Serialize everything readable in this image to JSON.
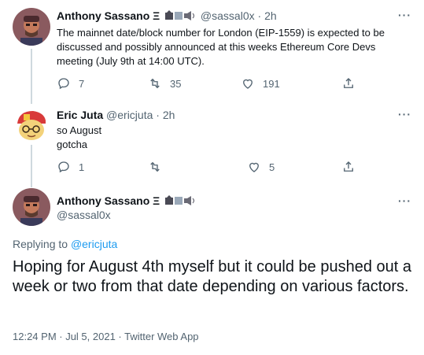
{
  "tweets": [
    {
      "name": "Anthony Sassano Ξ",
      "handle": "@sassal0x",
      "sep": "·",
      "time": "2h",
      "text": "The mainnet date/block number for London (EIP-1559) is expected to be discussed and possibly announced at this weeks Ethereum Core Devs meeting (July 9th at 14:00 UTC).",
      "replies": "7",
      "retweets": "35",
      "likes": "191"
    },
    {
      "name": "Eric Juta",
      "handle": "@ericjuta",
      "sep": "·",
      "time": "2h",
      "text_lines": [
        "so August",
        "gotcha"
      ],
      "replies": "1",
      "retweets": "",
      "likes": "5"
    }
  ],
  "main_tweet": {
    "name": "Anthony Sassano Ξ",
    "handle": "@sassal0x",
    "replying_prefix": "Replying to",
    "replying_to": "@ericjuta",
    "text": "Hoping for August 4th myself but it could be pushed out a week or two from that date depending on various factors.",
    "meta": "12:24 PM · Jul 5, 2021 · Twitter Web App"
  },
  "icons": {
    "reply": "reply-icon",
    "retweet": "retweet-icon",
    "like": "heart-icon",
    "share": "share-icon",
    "more": "more-icon"
  },
  "colors": {
    "text": "#0f1419",
    "secondary": "#536471",
    "link": "#1d9bf0",
    "thread_line": "#cfd9de"
  }
}
